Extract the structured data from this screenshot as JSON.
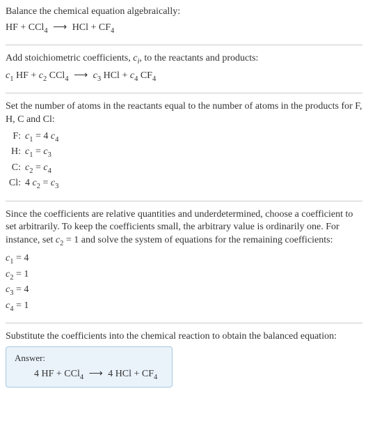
{
  "intro": {
    "title": "Balance the chemical equation algebraically:",
    "equation_html": "HF + CCl<span class='sub-num'>4</span> <span class='arrow'>⟶</span> HCl + CF<span class='sub-num'>4</span>"
  },
  "step1": {
    "text_html": "Add stoichiometric coefficients, <span class='coef'>c</span><span class='sub'>i</span>, to the reactants and products:",
    "equation_html": "<span class='coef'>c</span><span class='sub-num'>1</span> HF + <span class='coef'>c</span><span class='sub-num'>2</span> CCl<span class='sub-num'>4</span> <span class='arrow'>⟶</span> <span class='coef'>c</span><span class='sub-num'>3</span> HCl + <span class='coef'>c</span><span class='sub-num'>4</span> CF<span class='sub-num'>4</span>"
  },
  "step2": {
    "text": "Set the number of atoms in the reactants equal to the number of atoms in the products for F, H, C and Cl:",
    "rows": [
      {
        "label": "F:",
        "eq_html": "<span class='coef'>c</span><span class='sub-num'>1</span> = 4 <span class='coef'>c</span><span class='sub-num'>4</span>"
      },
      {
        "label": "H:",
        "eq_html": "<span class='coef'>c</span><span class='sub-num'>1</span> = <span class='coef'>c</span><span class='sub-num'>3</span>"
      },
      {
        "label": "C:",
        "eq_html": "<span class='coef'>c</span><span class='sub-num'>2</span> = <span class='coef'>c</span><span class='sub-num'>4</span>"
      },
      {
        "label": "Cl:",
        "eq_html": "4 <span class='coef'>c</span><span class='sub-num'>2</span> = <span class='coef'>c</span><span class='sub-num'>3</span>"
      }
    ]
  },
  "step3": {
    "text_html": "Since the coefficients are relative quantities and underdetermined, choose a coefficient to set arbitrarily. To keep the coefficients small, the arbitrary value is ordinarily one. For instance, set <span class='coef'>c</span><span class='sub-num'>2</span> = 1 and solve the system of equations for the remaining coefficients:",
    "solutions": [
      {
        "html": "<span class='coef'>c</span><span class='sub-num'>1</span> = 4"
      },
      {
        "html": "<span class='coef'>c</span><span class='sub-num'>2</span> = 1"
      },
      {
        "html": "<span class='coef'>c</span><span class='sub-num'>3</span> = 4"
      },
      {
        "html": "<span class='coef'>c</span><span class='sub-num'>4</span> = 1"
      }
    ]
  },
  "step4": {
    "text": "Substitute the coefficients into the chemical reaction to obtain the balanced equation:"
  },
  "answer": {
    "label": "Answer:",
    "equation_html": "4 HF + CCl<span class='sub-num'>4</span> <span class='arrow'>⟶</span> 4 HCl + CF<span class='sub-num'>4</span>"
  }
}
